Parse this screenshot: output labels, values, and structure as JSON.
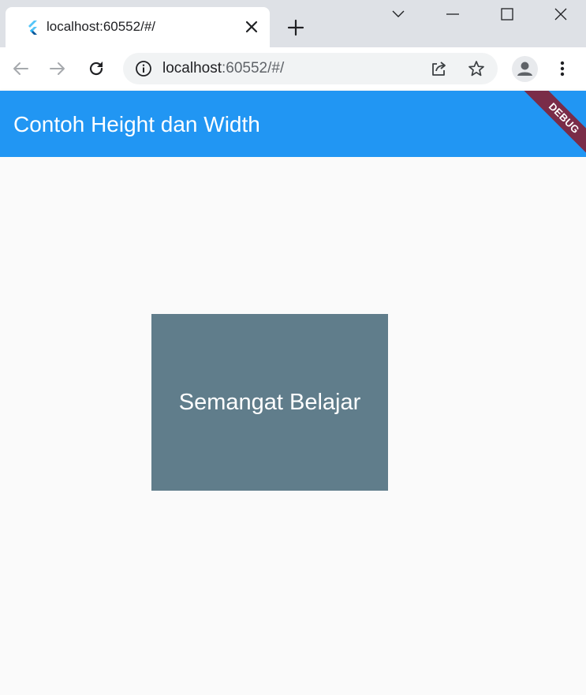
{
  "browser": {
    "tab": {
      "title": "localhost:60552/#/",
      "favicon": "flutter-icon"
    },
    "window_controls": [
      "chevron-down-icon",
      "minimize-icon",
      "maximize-icon",
      "close-icon"
    ],
    "address_bar": {
      "host": "localhost",
      "rest": ":60552/#/"
    }
  },
  "app": {
    "appbar_title": "Contoh Height dan Width",
    "debug_banner": "DEBUG",
    "box_text": "Semangat Belajar",
    "colors": {
      "appbar": "#2196f3",
      "box": "#607d8b",
      "banner": "#7a2c48",
      "background": "#fafafa"
    }
  }
}
